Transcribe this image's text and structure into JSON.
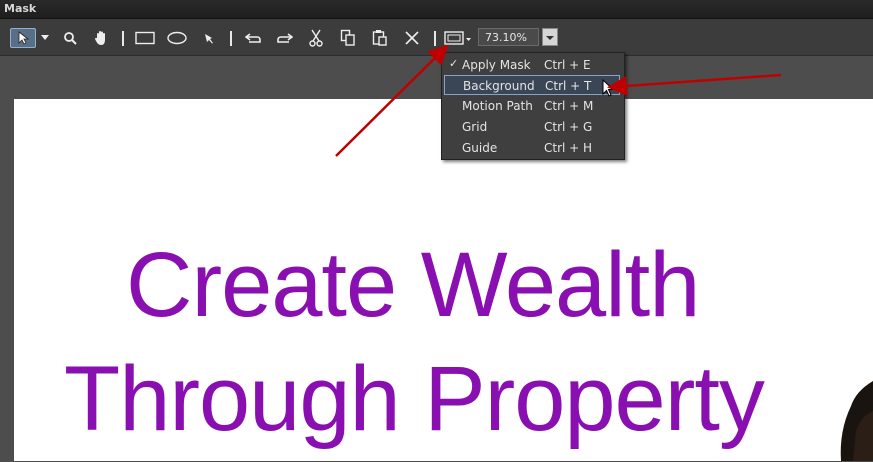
{
  "window": {
    "title": "Mask"
  },
  "toolbar": {
    "zoom_value": "73.10%",
    "icons": [
      "select-arrow-icon",
      "zoom-icon",
      "hand-icon",
      "rectangle-icon",
      "ellipse-icon",
      "pen-icon",
      "undo-icon",
      "redo-icon",
      "cut-icon",
      "copy-icon",
      "paste-icon",
      "delete-icon",
      "view-options-icon"
    ]
  },
  "menu": {
    "items": [
      {
        "label": "Apply Mask",
        "shortcut": "Ctrl + E",
        "checked": true
      },
      {
        "label": "Background",
        "shortcut": "Ctrl + T",
        "checked": false
      },
      {
        "label": "Motion Path",
        "shortcut": "Ctrl + M",
        "checked": false
      },
      {
        "label": "Grid",
        "shortcut": "Ctrl + G",
        "checked": false
      },
      {
        "label": "Guide",
        "shortcut": "Ctrl + H",
        "checked": false
      }
    ],
    "check_glyph": "✓"
  },
  "canvas": {
    "line1": "Create Wealth",
    "line2": "Through Property",
    "text_color": "#8a0fb0"
  },
  "annotations": {
    "arrow_color": "#c00000"
  }
}
